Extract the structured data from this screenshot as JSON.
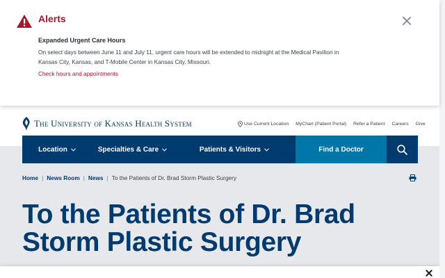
{
  "alert": {
    "title": "Alerts",
    "heading": "Expanded Urgent Care Hours",
    "body": "On select days between June 11 and July 11, urgent care hours will be extended to midnight at the Medical Pavilion in Kansas City, Kansas, and T-Mobile Center in Kansas City, Missouri.",
    "link": "Check hours and appointments",
    "icon": "warning-triangle-icon",
    "accent": "#a6192e"
  },
  "header": {
    "logo_text": "The University of Kansas Health System",
    "utility": [
      "Use Current Location",
      "MyChart (Patient Portal)",
      "Refer a Patient",
      "Careers",
      "Give"
    ]
  },
  "nav": {
    "location": "Location",
    "specialties": "Specialties & Care",
    "patients": "Patients & Visitors",
    "find_doctor": "Find a Doctor",
    "search_icon": "search-icon",
    "primary": "#003b6f",
    "accent": "#0076a8"
  },
  "breadcrumb": {
    "home": "Home",
    "newsroom": "News Room",
    "news": "News",
    "current": "To the Patients of Dr. Brad Storm Plastic Surgery"
  },
  "page": {
    "title": "To the Patients of Dr. Brad Storm Plastic Surgery"
  }
}
